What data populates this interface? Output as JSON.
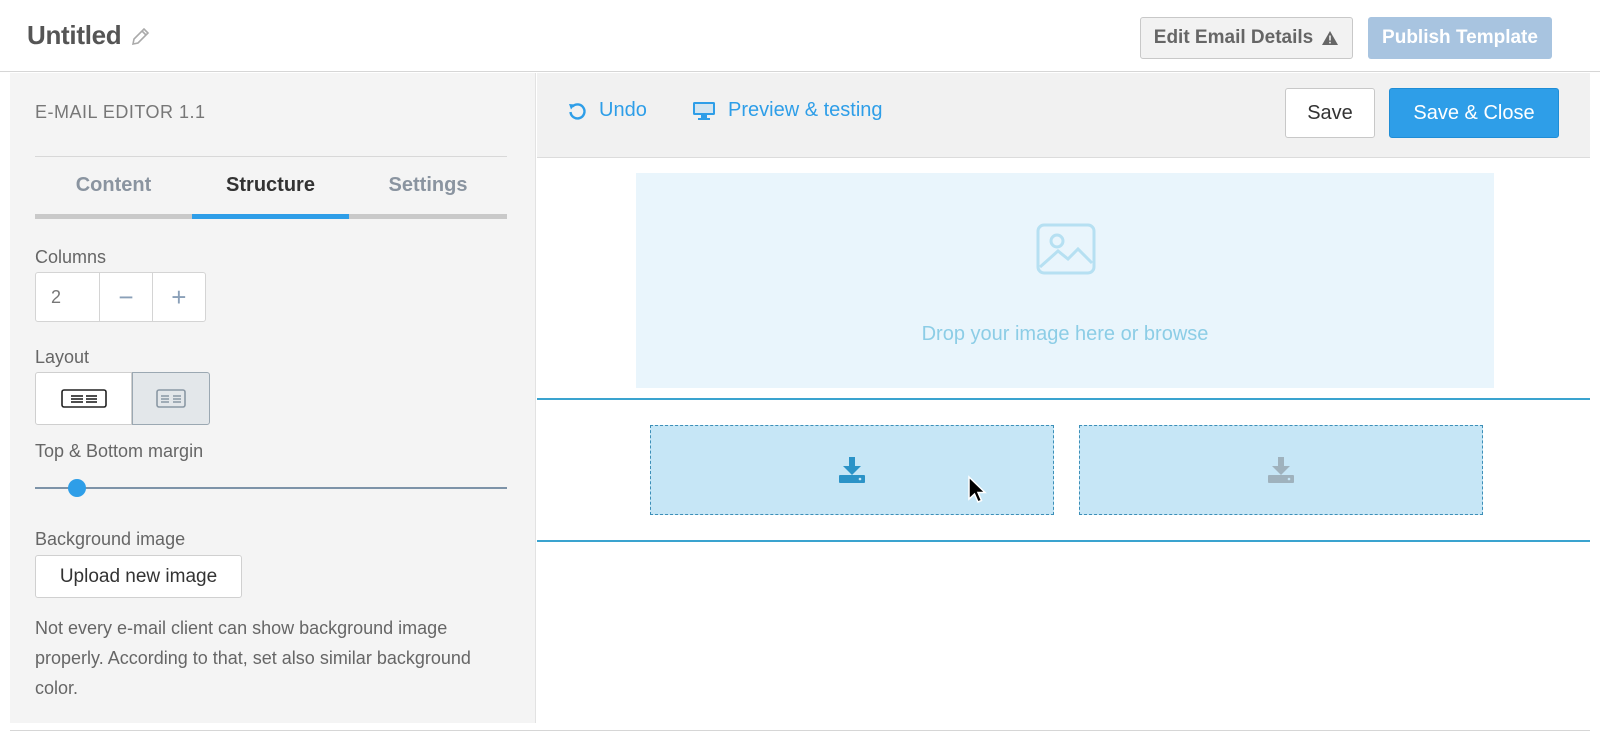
{
  "header": {
    "title": "Untitled",
    "edit_details_label": "Edit Email Details",
    "publish_label": "Publish Template"
  },
  "sidebar": {
    "editor_version": "E-MAIL EDITOR 1.1",
    "tabs": [
      {
        "label": "Content",
        "active": false
      },
      {
        "label": "Structure",
        "active": true
      },
      {
        "label": "Settings",
        "active": false
      }
    ],
    "columns_label": "Columns",
    "columns_value": "2",
    "columns_minus": "−",
    "columns_plus": "+",
    "layout_label": "Layout",
    "layout_options": [
      "layout-wide-left",
      "layout-equal"
    ],
    "layout_selected": 1,
    "margin_label": "Top & Bottom margin",
    "margin_value_fraction": 0.09,
    "bg_image_label": "Background image",
    "upload_label": "Upload new image",
    "note": "Not every e-mail client can show background image properly. According to that, set also similar background color."
  },
  "toolbar": {
    "undo_label": "Undo",
    "preview_label": "Preview & testing",
    "save_label": "Save",
    "save_close_label": "Save & Close"
  },
  "canvas": {
    "drop_text": "Drop your image here or browse",
    "slots": [
      {
        "icon": "download-icon",
        "state": "active"
      },
      {
        "icon": "download-icon",
        "state": "inactive"
      }
    ]
  },
  "colors": {
    "accent": "#2e9ee8",
    "publish_disabled": "#a8c4e0",
    "drop_zone": "#e9f5fc",
    "slot_fill": "#c6e6f6",
    "row_line": "#3aa3cf"
  }
}
